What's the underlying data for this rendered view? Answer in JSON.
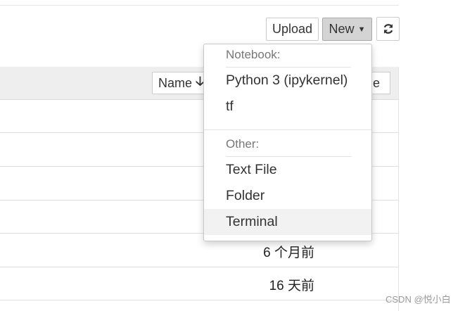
{
  "toolbar": {
    "upload_label": "Upload",
    "new_label": "New",
    "refresh_icon": "refresh-icon"
  },
  "list_header": {
    "sort_name_label": "Name",
    "sort_arrow": "🡣",
    "sort_modified_partial": "e"
  },
  "rows": [
    {
      "mtime": ""
    },
    {
      "mtime": ""
    },
    {
      "mtime": ""
    },
    {
      "mtime": ""
    },
    {
      "mtime": "6 个月前"
    },
    {
      "mtime": "16 天前"
    }
  ],
  "new_menu": {
    "notebook_header": "Notebook:",
    "notebook_items": [
      "Python 3 (ipykernel)",
      "tf"
    ],
    "other_header": "Other:",
    "other_items": [
      "Text File",
      "Folder",
      "Terminal"
    ],
    "highlighted_item": "Terminal"
  },
  "watermark": "CSDN @悦小白"
}
